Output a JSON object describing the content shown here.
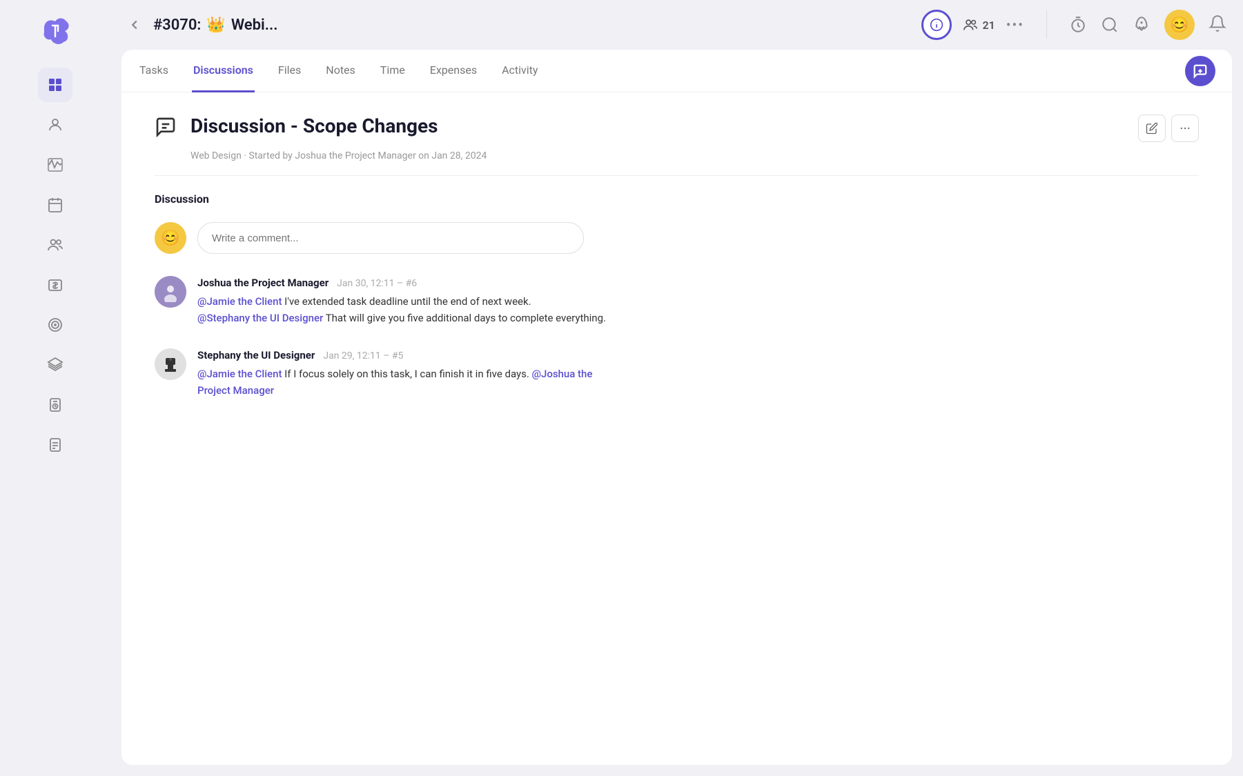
{
  "app": {
    "logo_alt": "App Logo"
  },
  "topbar": {
    "back_label": "‹",
    "project_number": "#3070:",
    "project_crown": "👑",
    "project_name": "Webi...",
    "members_count": "21",
    "more_label": "•••",
    "info_tooltip": "Info",
    "avatar_emoji": "😊",
    "notification_label": "Notifications"
  },
  "tabs": {
    "items": [
      {
        "label": "Tasks",
        "active": false
      },
      {
        "label": "Discussions",
        "active": true
      },
      {
        "label": "Files",
        "active": false
      },
      {
        "label": "Notes",
        "active": false
      },
      {
        "label": "Time",
        "active": false
      },
      {
        "label": "Expenses",
        "active": false
      },
      {
        "label": "Activity",
        "active": false
      }
    ],
    "new_button_label": "+"
  },
  "discussion": {
    "title": "Discussion - Scope Changes",
    "meta": "Web Design · Started by Joshua the Project Manager on Jan 28, 2024",
    "section_label": "Discussion",
    "comment_placeholder": "Write a comment...",
    "current_user_emoji": "😊",
    "comments": [
      {
        "username": "Joshua the Project Manager",
        "timestamp": "Jan 30, 12:11 – #6",
        "avatar_type": "purple",
        "lines": [
          {
            "mention": "@Jamie the Client",
            "text": "  I've extended task deadline until the end of next week."
          },
          {
            "mention": "@Stephany the UI Designer",
            "text": " That will give you five additional days to complete everything."
          }
        ]
      },
      {
        "username": "Stephany the UI Designer",
        "timestamp": "Jan 29, 12:11 – #5",
        "avatar_type": "gray",
        "lines": [
          {
            "mention": "@Jamie the Client",
            "text": " If I focus solely on this task, I can finish it in five days. ",
            "mention2": "@Joshua the Project Manager",
            "text2": ""
          }
        ]
      }
    ]
  },
  "sidebar": {
    "items": [
      {
        "name": "grid",
        "active": true
      },
      {
        "name": "person",
        "active": false
      },
      {
        "name": "activity",
        "active": false
      },
      {
        "name": "calendar",
        "active": false
      },
      {
        "name": "team",
        "active": false
      },
      {
        "name": "dollar",
        "active": false
      },
      {
        "name": "target",
        "active": false
      },
      {
        "name": "layers",
        "active": false
      },
      {
        "name": "clipboard-clock",
        "active": false
      },
      {
        "name": "report",
        "active": false
      }
    ]
  }
}
